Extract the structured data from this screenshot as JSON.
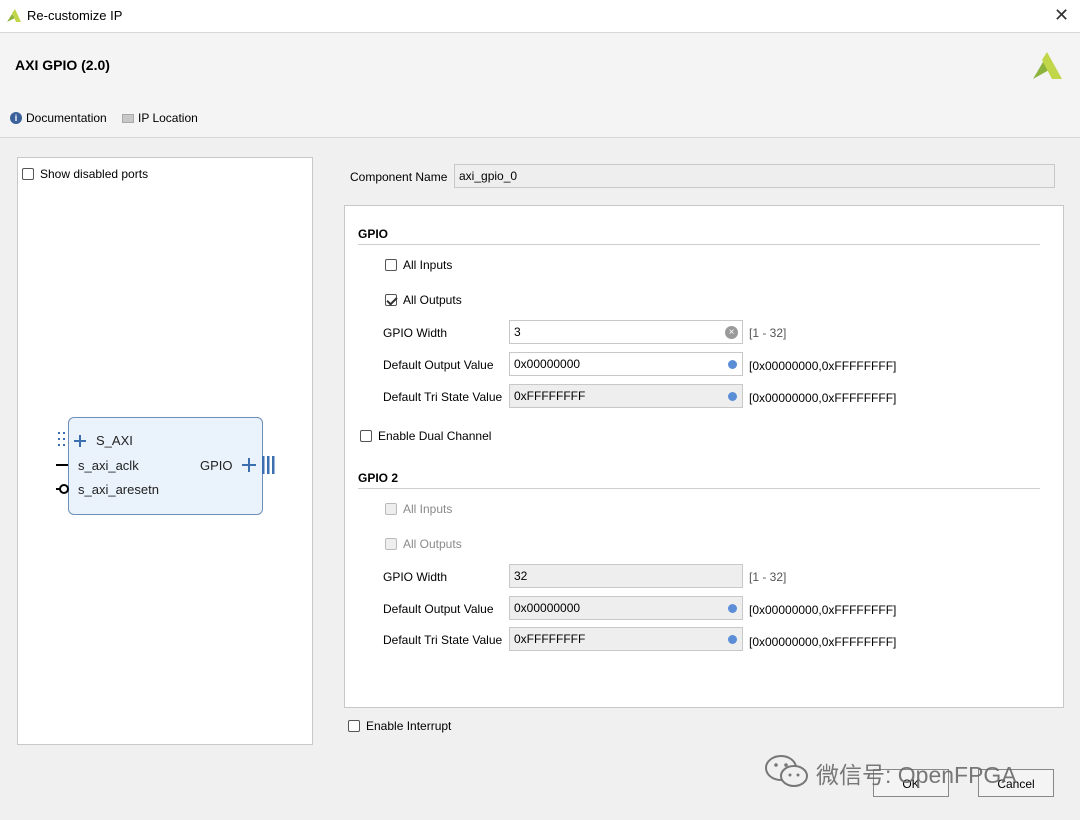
{
  "window": {
    "title": "Re-customize IP"
  },
  "header": {
    "ip_title": "AXI GPIO (2.0)",
    "doc_label": "Documentation",
    "ip_location_label": "IP Location"
  },
  "left": {
    "show_disabled_label": "Show disabled ports",
    "block": {
      "ports_left": [
        "S_AXI",
        "s_axi_aclk",
        "s_axi_aresetn"
      ],
      "port_right": "GPIO"
    }
  },
  "component": {
    "label": "Component Name",
    "value": "axi_gpio_0"
  },
  "gpio": {
    "title": "GPIO",
    "all_inputs": {
      "label": "All Inputs",
      "checked": false
    },
    "all_outputs": {
      "label": "All Outputs",
      "checked": true
    },
    "width": {
      "label": "GPIO Width",
      "value": "3",
      "range": "[1 - 32]"
    },
    "default_out": {
      "label": "Default Output Value",
      "value": "0x00000000",
      "range": "[0x00000000,0xFFFFFFFF]"
    },
    "default_tri": {
      "label": "Default Tri State Value",
      "value": "0xFFFFFFFF",
      "range": "[0x00000000,0xFFFFFFFF]"
    }
  },
  "dual_channel": {
    "label": "Enable Dual Channel",
    "checked": false
  },
  "gpio2": {
    "title": "GPIO 2",
    "all_inputs": {
      "label": "All Inputs"
    },
    "all_outputs": {
      "label": "All Outputs"
    },
    "width": {
      "label": "GPIO Width",
      "value": "32",
      "range": "[1 - 32]"
    },
    "default_out": {
      "label": "Default Output Value",
      "value": "0x00000000",
      "range": "[0x00000000,0xFFFFFFFF]"
    },
    "default_tri": {
      "label": "Default Tri State Value",
      "value": "0xFFFFFFFF",
      "range": "[0x00000000,0xFFFFFFFF]"
    }
  },
  "interrupt": {
    "label": "Enable Interrupt",
    "checked": false
  },
  "footer": {
    "ok_label": "OK",
    "cancel_label": "Cancel",
    "watermark": "微信号: OpenFPGA"
  },
  "colors": {
    "accent": "#5b8ed6",
    "logo": "#8cb33c"
  }
}
